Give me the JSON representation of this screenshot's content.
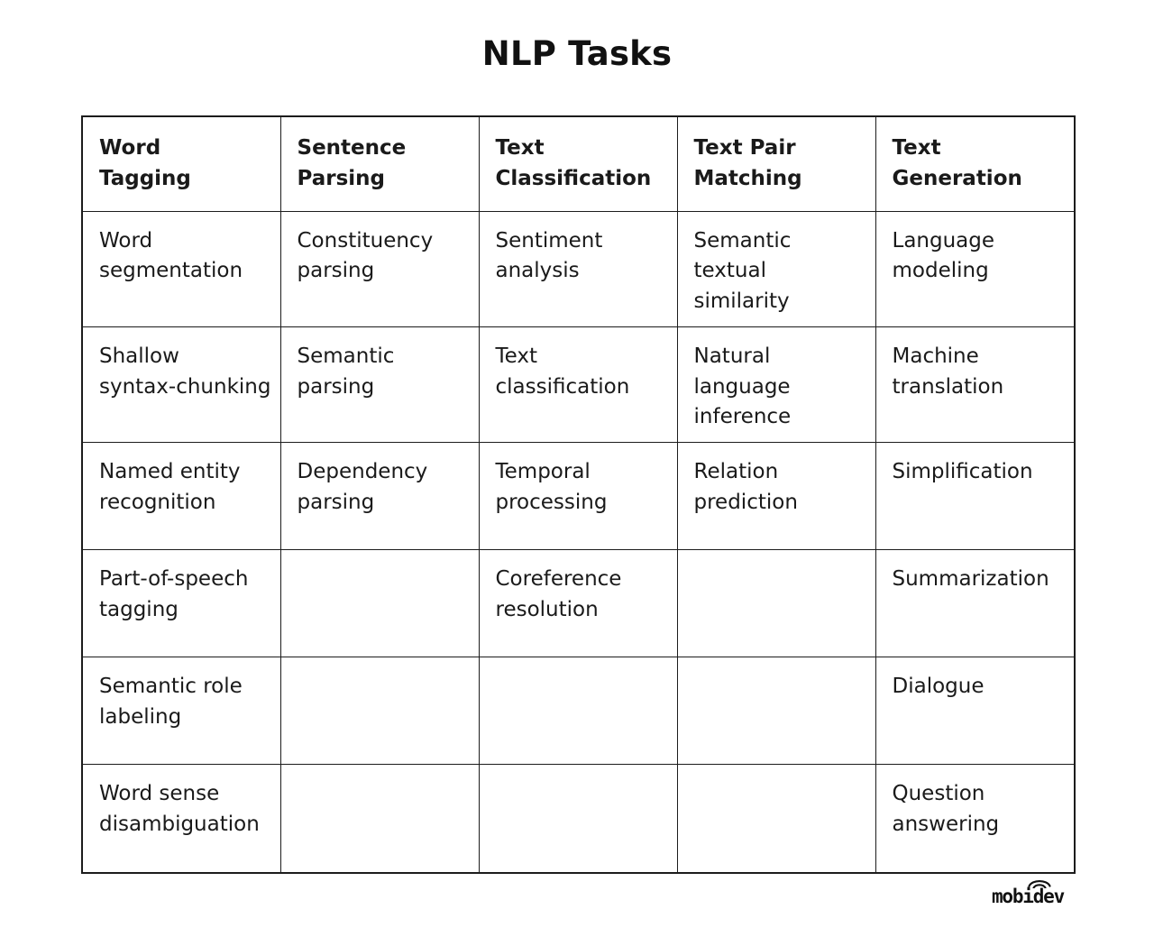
{
  "title": "NLP Tasks",
  "table": {
    "headers": [
      "Word\nTagging",
      "Sentence\nParsing",
      "Text\nClassification",
      "Text Pair\nMatching",
      "Text\nGeneration"
    ],
    "rows": [
      [
        "Word\nsegmentation",
        "Constituency\nparsing",
        "Sentiment\nanalysis",
        "Semantic\ntextual\nsimilarity",
        "Language\nmodeling"
      ],
      [
        "Shallow\nsyntax-chunking",
        "Semantic\nparsing",
        "Text\nclassification",
        "Natural\nlanguage\ninference",
        "Machine\ntranslation"
      ],
      [
        "Named entity\nrecognition",
        "Dependency\nparsing",
        "Temporal\nprocessing",
        "Relation\nprediction",
        "Simplification"
      ],
      [
        "Part-of-speech\ntagging",
        "",
        "Coreference\nresolution",
        "",
        "Summarization"
      ],
      [
        "Semantic role\nlabeling",
        "",
        "",
        "",
        "Dialogue"
      ],
      [
        "Word sense\ndisambiguation",
        "",
        "",
        "",
        "Question\nanswering"
      ]
    ]
  },
  "logo": {
    "text": "mobidev",
    "mark": "wifi-arc-icon"
  },
  "colors": {
    "background": "#ffffff",
    "text": "#1a1a1a",
    "border": "#1c1c1c",
    "title": "#111111"
  }
}
